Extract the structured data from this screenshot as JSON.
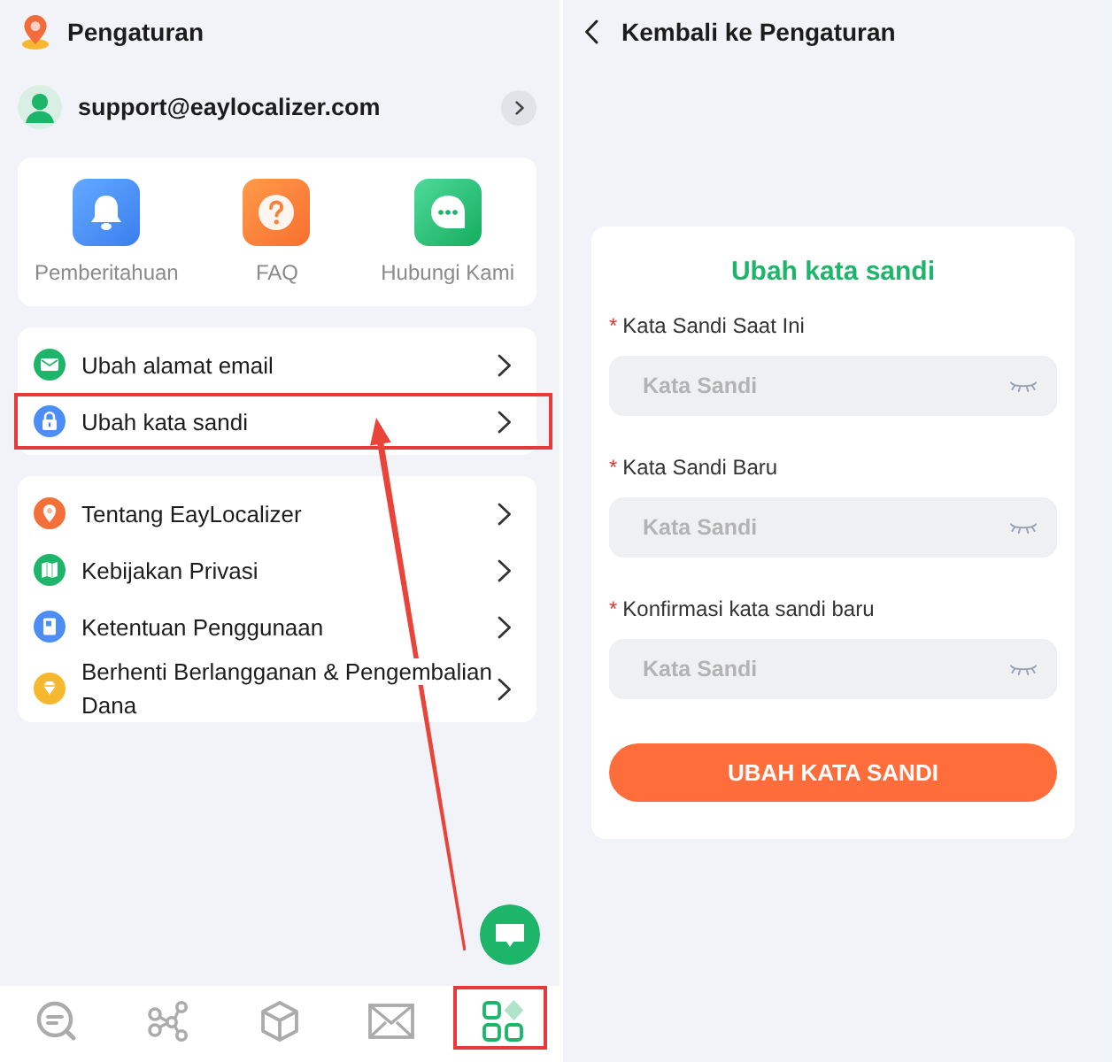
{
  "settings": {
    "title": "Pengaturan",
    "account": {
      "email": "support@eaylocalizer.com"
    },
    "shortcuts": [
      {
        "kind": "bell",
        "label": "Pemberitahuan"
      },
      {
        "kind": "question",
        "label": "FAQ"
      },
      {
        "kind": "chat",
        "label": "Hubungi Kami"
      }
    ],
    "account_menu": [
      {
        "kind": "envelope",
        "label": "Ubah alamat email",
        "highlighted": false
      },
      {
        "kind": "lock",
        "label": "Ubah kata sandi",
        "highlighted": true
      }
    ],
    "info_menu": [
      {
        "kind": "pin",
        "label": "Tentang EayLocalizer",
        "highlighted": false
      },
      {
        "kind": "map",
        "label": "Kebijakan Privasi",
        "highlighted": false
      },
      {
        "kind": "document",
        "label": "Ketentuan Penggunaan",
        "highlighted": false
      },
      {
        "kind": "diamond",
        "label": "Berhenti Berlangganan & Pengembalian Dana",
        "highlighted": false
      }
    ],
    "bottom_nav": [
      {
        "kind": "chat-search",
        "selected": false,
        "highlighted": false
      },
      {
        "kind": "share",
        "selected": false,
        "highlighted": false
      },
      {
        "kind": "cube",
        "selected": false,
        "highlighted": false
      },
      {
        "kind": "envelope",
        "selected": false,
        "highlighted": false
      },
      {
        "kind": "apps",
        "selected": true,
        "highlighted": true
      }
    ]
  },
  "change_password": {
    "back_label": "Kembali ke Pengaturan",
    "form": {
      "title": "Ubah kata sandi",
      "fields": [
        {
          "required_mark": "*",
          "label": "Kata Sandi Saat Ini",
          "placeholder": "Kata Sandi"
        },
        {
          "required_mark": "*",
          "label": "Kata Sandi Baru",
          "placeholder": "Kata Sandi"
        },
        {
          "required_mark": "*",
          "label": "Konfirmasi kata sandi baru",
          "placeholder": "Kata Sandi"
        }
      ],
      "submit": "UBAH KATA SANDI"
    }
  }
}
